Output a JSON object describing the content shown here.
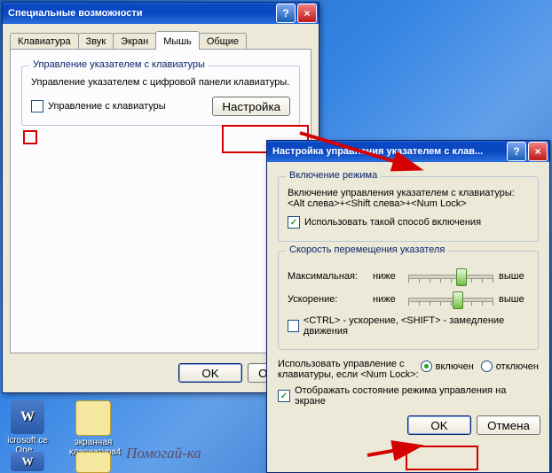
{
  "desktop": {
    "icons": [
      {
        "label": "icrosoft\nce One..."
      },
      {
        "label": "экранная\nклавиатура4"
      }
    ],
    "caption": "Помогай-ка"
  },
  "win1": {
    "title": "Специальные возможности",
    "tabs": [
      "Клавиатура",
      "Звук",
      "Экран",
      "Мышь",
      "Общие"
    ],
    "active_tab": "Мышь",
    "group_title": "Управление указателем с клавиатуры",
    "desc": "Управление указателем с цифровой панели клавиатуры.",
    "checkbox": "Управление с клавиатуры",
    "settings_btn": "Настройка",
    "ok": "OK",
    "cancel": "Отмена"
  },
  "win2": {
    "title": "Настройка управления указателем с клав...",
    "g1": {
      "title": "Включение режима",
      "desc": "Включение управления указателем с клавиатуры:\n<Alt слева>+<Shift слева>+<Num Lock>",
      "checkbox": "Использовать такой способ включения"
    },
    "g2": {
      "title": "Скорость перемещения указателя",
      "max": "Максимальная:",
      "accel": "Ускорение:",
      "low": "ниже",
      "high": "выше",
      "ctrl_shift": "<CTRL> - ускорение, <SHIFT> - замедление движения"
    },
    "numlock_label": "Использовать управление с клавиатуры, если <Num Lock>:",
    "on": "включен",
    "off": "отключен",
    "show_state": "Отображать состояние режима управления на экране",
    "ok": "OK",
    "cancel": "Отмена"
  }
}
